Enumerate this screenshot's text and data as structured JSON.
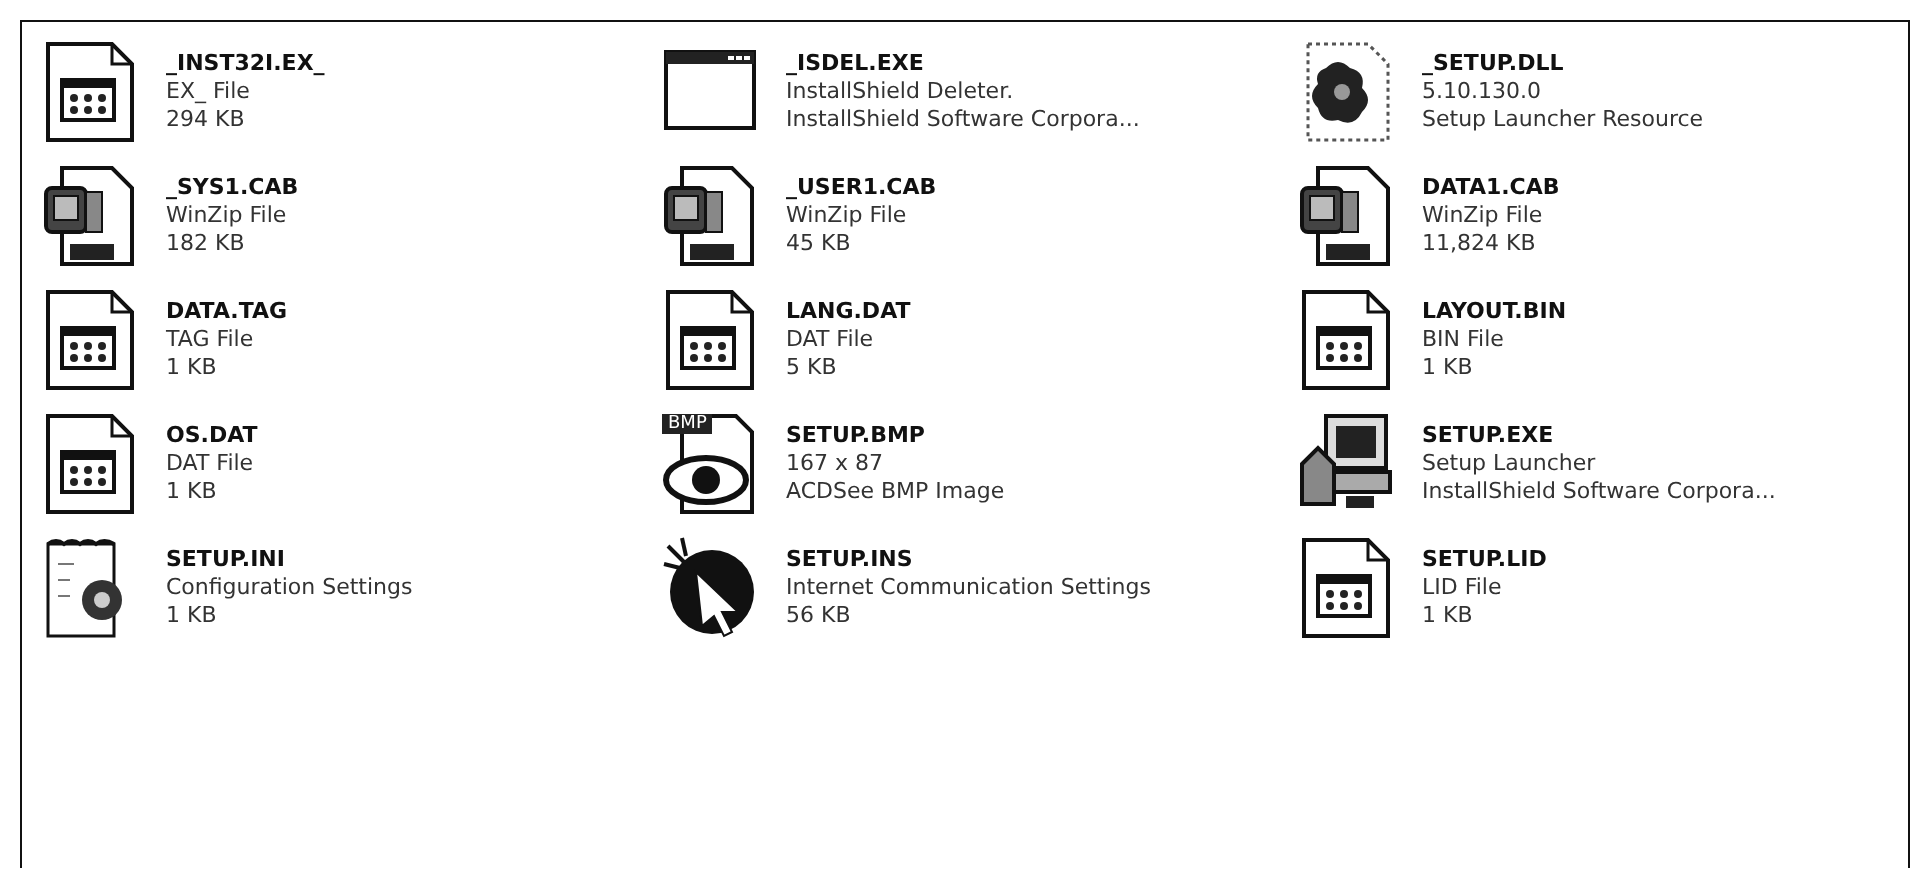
{
  "files": [
    {
      "name": "_INST32I.EX_",
      "kind": "document",
      "lines": [
        "EX_ File",
        "294 KB"
      ]
    },
    {
      "name": "_ISDEL.EXE",
      "kind": "window",
      "lines": [
        "InstallShield Deleter.",
        "InstallShield Software Corpora..."
      ]
    },
    {
      "name": "_SETUP.DLL",
      "kind": "dll",
      "lines": [
        "5.10.130.0",
        "Setup Launcher Resource"
      ]
    },
    {
      "name": "_SYS1.CAB",
      "kind": "cab",
      "lines": [
        "WinZip File",
        "182 KB"
      ]
    },
    {
      "name": "_USER1.CAB",
      "kind": "cab",
      "lines": [
        "WinZip File",
        "45 KB"
      ]
    },
    {
      "name": "DATA1.CAB",
      "kind": "cab",
      "lines": [
        "WinZip File",
        "11,824 KB"
      ]
    },
    {
      "name": "DATA.TAG",
      "kind": "document",
      "lines": [
        "TAG File",
        "1 KB"
      ]
    },
    {
      "name": "LANG.DAT",
      "kind": "document",
      "lines": [
        "DAT File",
        "5 KB"
      ]
    },
    {
      "name": "LAYOUT.BIN",
      "kind": "document",
      "lines": [
        "BIN File",
        "1 KB"
      ]
    },
    {
      "name": "OS.DAT",
      "kind": "document",
      "lines": [
        "DAT File",
        "1 KB"
      ]
    },
    {
      "name": "SETUP.BMP",
      "kind": "bmp",
      "badge": "BMP",
      "lines": [
        "167 x 87",
        "ACDSee BMP Image"
      ]
    },
    {
      "name": "SETUP.EXE",
      "kind": "setup",
      "lines": [
        "Setup Launcher",
        "InstallShield Software Corpora..."
      ]
    },
    {
      "name": "SETUP.INI",
      "kind": "ini",
      "lines": [
        "Configuration Settings",
        "1 KB"
      ]
    },
    {
      "name": "SETUP.INS",
      "kind": "ins",
      "lines": [
        "Internet Communication Settings",
        "56 KB"
      ]
    },
    {
      "name": "SETUP.LID",
      "kind": "document",
      "lines": [
        "LID File",
        "1 KB"
      ]
    }
  ]
}
